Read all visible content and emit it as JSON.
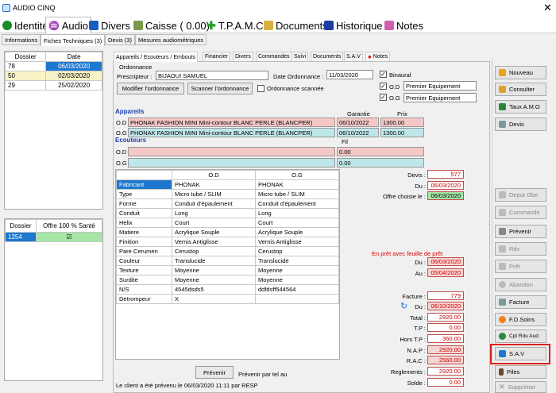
{
  "window": {
    "title": "AUDIO CINQ",
    "close": "✕"
  },
  "main_tabs": [
    {
      "label": "Identité",
      "color": "#1a8a2a"
    },
    {
      "label": "Audio",
      "color": "#555"
    },
    {
      "label": "Divers",
      "color": "#1a5fc0"
    },
    {
      "label": "Caisse ( 0.00)",
      "color": "#6a8a3a"
    },
    {
      "label": "T.P.A.M.C",
      "color": "#22a022"
    },
    {
      "label": "Documents",
      "color": "#c8a020"
    },
    {
      "label": "Historique",
      "color": "#1a3fa0"
    },
    {
      "label": "Notes",
      "color": "#c040a0"
    }
  ],
  "sub_tabs": [
    "Informations",
    "Fiches Techniques (3)",
    "Devis (3)",
    "Mesures audiométriques"
  ],
  "dossier_table": {
    "headers": [
      "Dossier",
      "Date"
    ],
    "rows": [
      [
        "78",
        "06/03/2020"
      ],
      [
        "50",
        "02/03/2020"
      ],
      [
        "29",
        "25/02/2020"
      ]
    ]
  },
  "sante_table": {
    "headers": [
      "Dossier",
      "Offre 100 % Santé"
    ],
    "rows": [
      [
        "1254",
        "☑"
      ]
    ]
  },
  "panel_tabs": [
    "Appareils / Ecouteurs / Embouts",
    "Financier",
    "Divers",
    "Commandes",
    "Suivi",
    "Documents",
    "S.A.V",
    "Notes"
  ],
  "ordonnance": {
    "section": "Ordonnance",
    "prescripteur_label": "Prescripteur :",
    "prescripteur": "BIJAOUI SAMUEL",
    "date_label": "Date Ordonnance :",
    "date": "11/03/2020",
    "binaural": "Binaural",
    "od": "O.D",
    "og": "O.G",
    "od_value": "Premier Equipement",
    "og_value": "Premier Equipement",
    "modify_btn": "Modifier l'ordonnance",
    "scan_btn": "Scanner l'ordonnance",
    "scanned_label": "Ordonnance scannée"
  },
  "appareils": {
    "title": "Appareils",
    "garantie": "Garantie",
    "prix": "Prix",
    "od_label": "O.D",
    "og_label": "O.G",
    "od_name": "PHONAK FASHION MINI Mini-contour BLANC PERLE (BLANCPER)",
    "og_name": "PHONAK FASHION MINI Mini-contour BLANC PERLE (BLANCPER)",
    "od_gar": "06/10/2022",
    "og_gar": "06/10/2022",
    "od_prix": "1300.00",
    "og_prix": "1300.00"
  },
  "ecouteurs": {
    "title": "Ecouteurs",
    "fil": "Fil",
    "od_label": "O.D",
    "og_label": "O.G",
    "od_fil": "0.00",
    "og_fil": "0.00"
  },
  "details": {
    "headers": [
      "",
      "O.D",
      "O.G"
    ],
    "rows": [
      [
        "Fabricant",
        "PHONAK",
        "PHONAK"
      ],
      [
        "Type",
        "Micro tube / SLIM",
        "Micro tube / SLIM"
      ],
      [
        "Forme",
        "Conduit d'épaulement",
        "Conduit d'épaulement"
      ],
      [
        "Conduit",
        "Long",
        "Long"
      ],
      [
        "Helix",
        "Court",
        "Court"
      ],
      [
        "Matiere",
        "Acrylique Souple",
        "Acrylique Souple"
      ],
      [
        "Finition",
        "Vernis Antiglisse",
        "Vernis Antiglisse"
      ],
      [
        "Pare Cerumen",
        "Cerustop",
        "Cerustop"
      ],
      [
        "Couleur",
        "Translucide",
        "Translucide"
      ],
      [
        "Texture",
        "Moyenne",
        "Moyenne"
      ],
      [
        "Surdite",
        "Moyenne",
        "Moyenne"
      ],
      [
        "N/S",
        "4545dsds5",
        "ddfdsff544564"
      ],
      [
        "Detrompeur",
        "X",
        ""
      ]
    ]
  },
  "devis": {
    "devis_label": "Devis :",
    "devis": "577",
    "du_label": "Du :",
    "du": "06/03/2020",
    "offre_label": "Offre choisie le :",
    "offre": "06/03/2020"
  },
  "pret": {
    "title": "En prêt avec feuille de prêt",
    "du_label": "Du :",
    "du": "06/03/2020",
    "au_label": "Au :",
    "au": "05/04/2020"
  },
  "facture": {
    "facture_label": "Facture :",
    "facture": "779",
    "du_label": "Du :",
    "du": "06/10/2020",
    "total_label": "Total :",
    "total": "2920.00",
    "tp_label": "T.P :",
    "tp": "0.00",
    "horstp_label": "Hors T.P :",
    "horstp": "360.00",
    "nap_label": "N.A.P :",
    "nap": "2920.00",
    "rac_label": "R.A.C :",
    "rac": "2560.00",
    "reg_label": "Reglements :",
    "reg": "2920.00",
    "solde_label": "Solde :",
    "solde": "0.00"
  },
  "prevenir": {
    "btn": "Prévenir",
    "text": "Prévenir par tel au",
    "footer": "Le client a été prévenu le 06/03/2020 11:11 par RESP"
  },
  "right_buttons": [
    "Nouveau",
    "Consulter",
    "Taux A.M.O",
    "Devis",
    "Depot Gbe",
    "Commande",
    "Prévenir",
    "Rdv",
    "Prêt",
    "Abandon",
    "Facture",
    "F.D.Soins",
    "Cpt Rdu Aud",
    "S.A.V",
    "Piles",
    "Supprimer"
  ]
}
